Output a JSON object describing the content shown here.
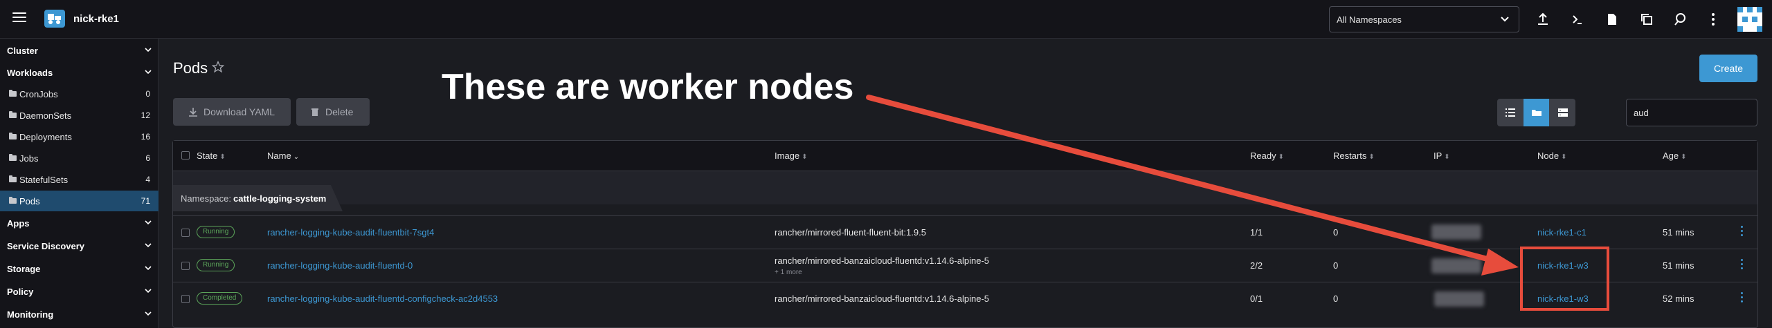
{
  "header": {
    "cluster_name": "nick-rke1",
    "namespace_select": "All Namespaces"
  },
  "sidebar": {
    "groups_top": [
      {
        "label": "Cluster"
      },
      {
        "label": "Workloads"
      }
    ],
    "items": [
      {
        "label": "CronJobs",
        "count": "0"
      },
      {
        "label": "DaemonSets",
        "count": "12"
      },
      {
        "label": "Deployments",
        "count": "16"
      },
      {
        "label": "Jobs",
        "count": "6"
      },
      {
        "label": "StatefulSets",
        "count": "4"
      },
      {
        "label": "Pods",
        "count": "71"
      }
    ],
    "groups_bottom": [
      {
        "label": "Apps"
      },
      {
        "label": "Service Discovery"
      },
      {
        "label": "Storage"
      },
      {
        "label": "Policy"
      },
      {
        "label": "Monitoring"
      }
    ]
  },
  "main": {
    "title": "Pods",
    "create_label": "Create",
    "download_label": "Download YAML",
    "delete_label": "Delete",
    "search_value": "aud"
  },
  "annotation": {
    "text": "These are worker nodes",
    "color": "#e74c3c"
  },
  "table": {
    "columns": [
      "State",
      "Name",
      "Image",
      "Ready",
      "Restarts",
      "IP",
      "Node",
      "Age"
    ],
    "namespace_label": "Namespace:",
    "namespace_value": "cattle-logging-system",
    "rows": [
      {
        "state": "Running",
        "name": "rancher-logging-kube-audit-fluentbit-7sgt4",
        "image": "rancher/mirrored-fluent-fluent-bit:1.9.5",
        "image_more": "",
        "ready": "1/1",
        "restarts": "0",
        "node": "nick-rke1-c1",
        "age": "51 mins"
      },
      {
        "state": "Running",
        "name": "rancher-logging-kube-audit-fluentd-0",
        "image": "rancher/mirrored-banzaicloud-fluentd:v1.14.6-alpine-5",
        "image_more": "+ 1 more",
        "ready": "2/2",
        "restarts": "0",
        "node": "nick-rke1-w3",
        "age": "51 mins"
      },
      {
        "state": "Completed",
        "name": "rancher-logging-kube-audit-fluentd-configcheck-ac2d4553",
        "image": "rancher/mirrored-banzaicloud-fluentd:v1.14.6-alpine-5",
        "image_more": "",
        "ready": "0/1",
        "restarts": "0",
        "node": "nick-rke1-w3",
        "age": "52 mins"
      }
    ]
  },
  "colors": {
    "accent": "#3d98d3",
    "status_green": "#5ca65a"
  }
}
